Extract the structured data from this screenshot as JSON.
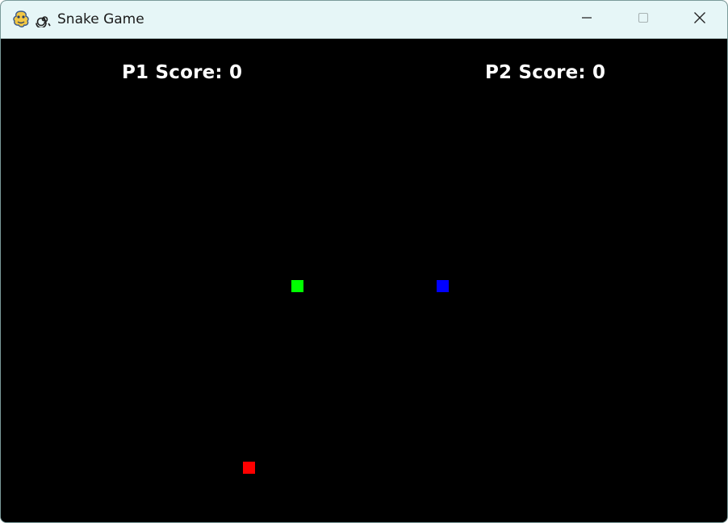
{
  "window": {
    "title": "Snake Game"
  },
  "scores": {
    "p1": "P1 Score: 0",
    "p2": "P2 Score: 0"
  },
  "game": {
    "player1_color": "#00ff00",
    "player2_color": "#0000ff",
    "food_color": "#ff0000"
  },
  "icons": [
    "pygame-snake-icon",
    "spiral-icon",
    "minimize-icon",
    "maximize-icon",
    "close-icon"
  ]
}
